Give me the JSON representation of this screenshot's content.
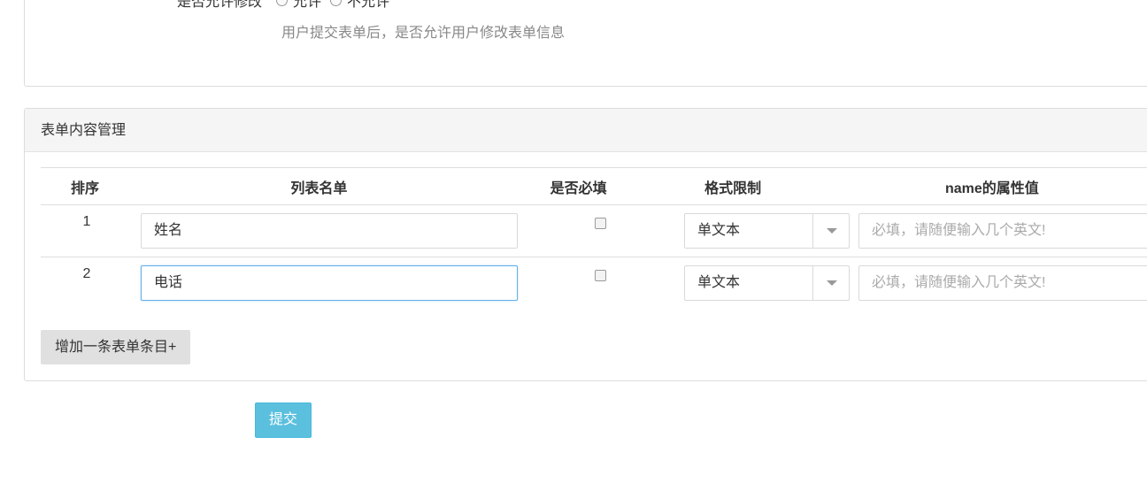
{
  "allow_edit": {
    "label": "是否允许修改",
    "options": [
      "允许",
      "不允许"
    ],
    "help": "用户提交表单后，是否允许用户修改表单信息"
  },
  "panel": {
    "title": "表单内容管理",
    "columns": [
      "排序",
      "列表名单",
      "是否必填",
      "格式限制",
      "name的属性值"
    ],
    "rows": [
      {
        "order": "1",
        "name": "姓名",
        "format": "单文本",
        "placeholder": "必填，请随便输入几个英文!"
      },
      {
        "order": "2",
        "name": "电话",
        "format": "单文本",
        "placeholder": "必填，请随便输入几个英文!"
      }
    ],
    "add_button": "增加一条表单条目+"
  },
  "submit_button": "提交",
  "colors": {
    "submit": "#5bc0de",
    "focus_border": "#66afe9"
  }
}
